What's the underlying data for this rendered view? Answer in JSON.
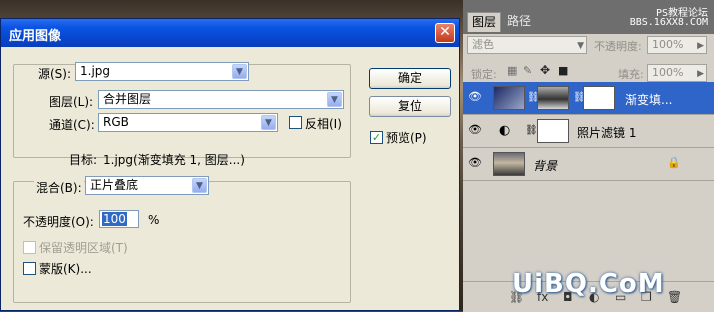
{
  "dialog": {
    "title": "应用图像",
    "close": "✕",
    "source_label": "源(S):",
    "source_value": "1.jpg",
    "layer_label": "图层(L):",
    "layer_value": "合并图层",
    "channel_label": "通道(C):",
    "channel_value": "RGB",
    "invert_label": "反相(I)",
    "target_label": "目标:",
    "target_value": "1.jpg(渐变填充 1, 图层...)",
    "blend_label": "混合(B):",
    "blend_value": "正片叠底",
    "opacity_label": "不透明度(O):",
    "opacity_value": "100",
    "opacity_unit": "%",
    "preserve_label": "保留透明区域(T)",
    "mask_label": "蒙版(K)...",
    "ok": "确定",
    "reset": "复位",
    "preview_label": "预览(P)",
    "preview_checked": true,
    "invert_checked": false,
    "mask_checked": false
  },
  "panel": {
    "tabs": [
      "图层",
      "路径"
    ],
    "watermark1": "PS教程论坛",
    "watermark2": "BBS.16XX8.COM",
    "blend_mode": "滤色",
    "opacity_label": "不透明度:",
    "opacity_value": "100%",
    "lock_label": "锁定:",
    "fill_label": "填充:",
    "fill_value": "100%",
    "layers": [
      {
        "name": "渐变填...",
        "selected": true
      },
      {
        "name": "照片滤镜 1",
        "selected": false
      },
      {
        "name": "背景",
        "selected": false,
        "locked": true
      }
    ]
  },
  "watermark_logo": "UiBQ.CoM",
  "colors": {
    "title_blue": "#0a54e3",
    "selected_row": "#2f65c8"
  }
}
